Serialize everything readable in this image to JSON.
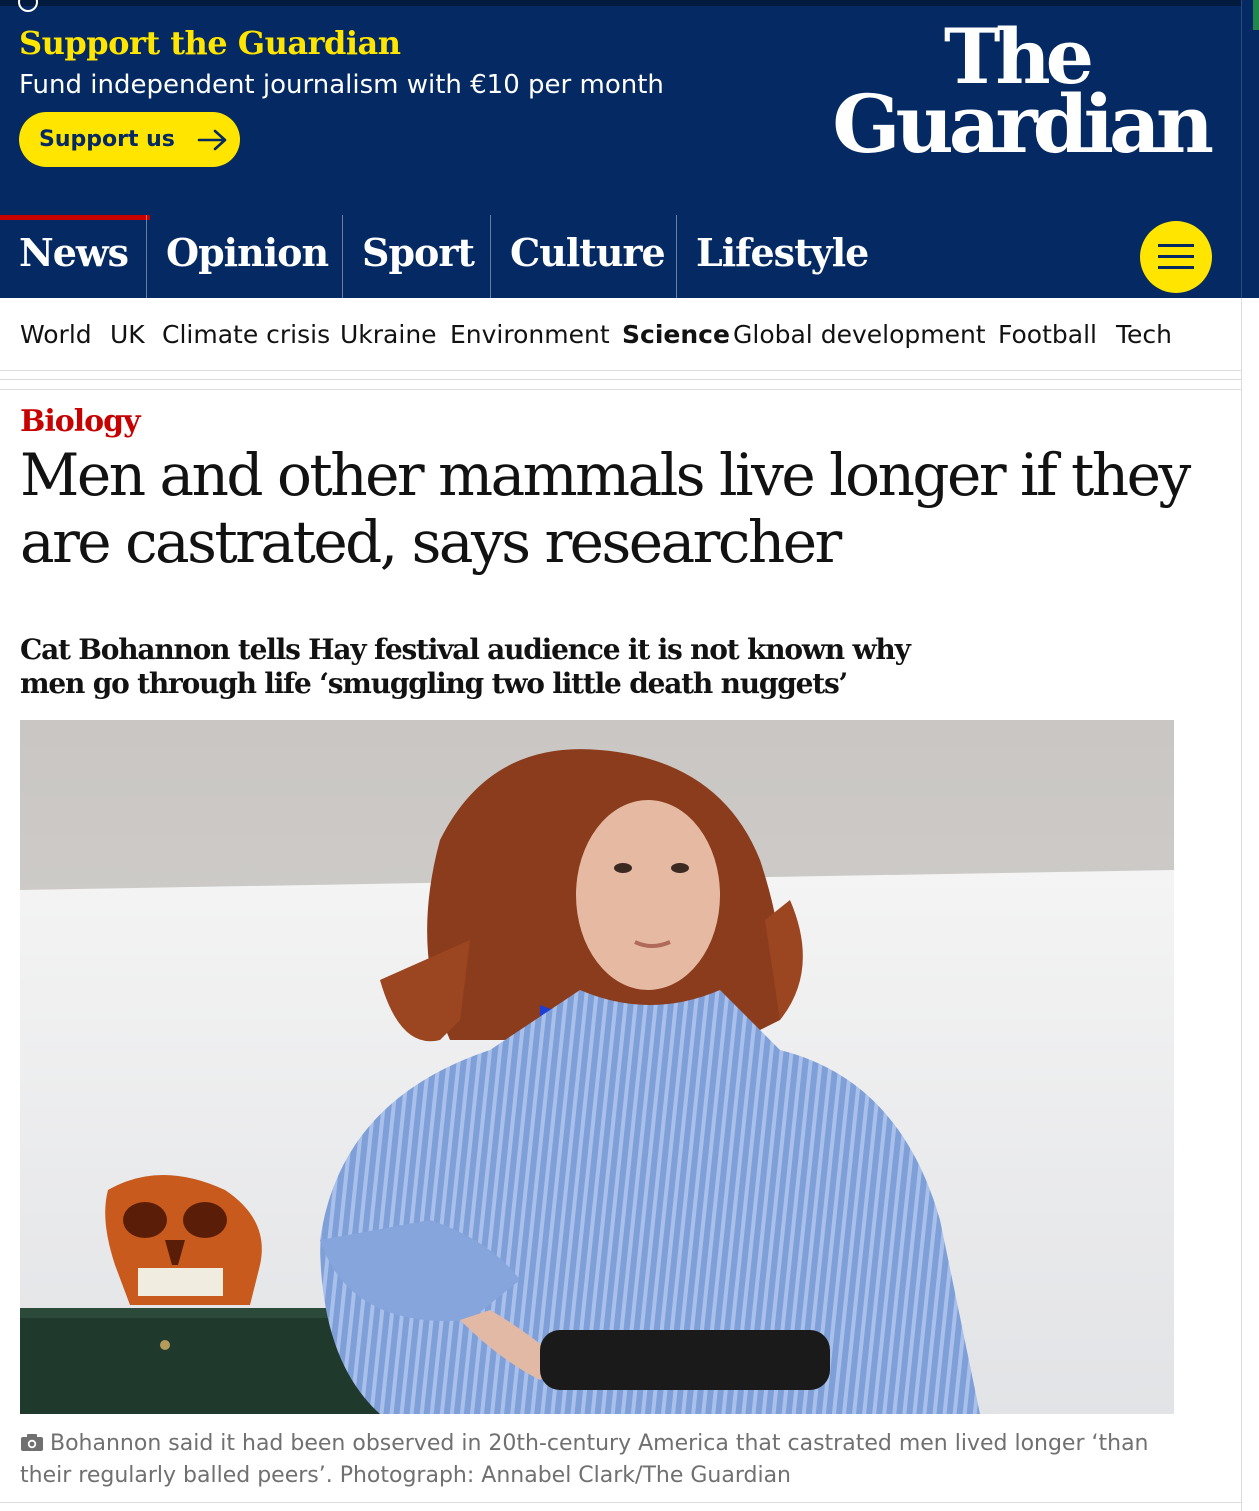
{
  "banner": {
    "title": "Support the Guardian",
    "subtitle": "Fund independent journalism with €10 per month",
    "button_label": "Support us"
  },
  "logo": {
    "line1": "The",
    "line2": "Guardian"
  },
  "pillars": [
    "News",
    "Opinion",
    "Sport",
    "Culture",
    "Lifestyle"
  ],
  "subnav": [
    "World",
    "UK",
    "Climate crisis",
    "Ukraine",
    "Environment",
    "Science",
    "Global development",
    "Football",
    "Tech"
  ],
  "article": {
    "kicker": "Biology",
    "headline": "Men and other mammals live longer if they are castrated, says researcher",
    "standfirst": "Cat Bohannon tells Hay festival audience it is not known why men go through life ‘smuggling two little death nuggets’",
    "caption": "Bohannon said it had been observed in 20th-century America that castrated men lived longer ‘than their regularly balled peers’. Photograph: Annabel Clark/The Guardian"
  },
  "icons": {
    "arrow": "arrow-right-icon",
    "menu": "hamburger-menu-icon",
    "camera": "camera-icon"
  },
  "colors": {
    "brand_blue": "#052962",
    "support_yellow": "#ffe500",
    "news_red": "#c70000"
  }
}
